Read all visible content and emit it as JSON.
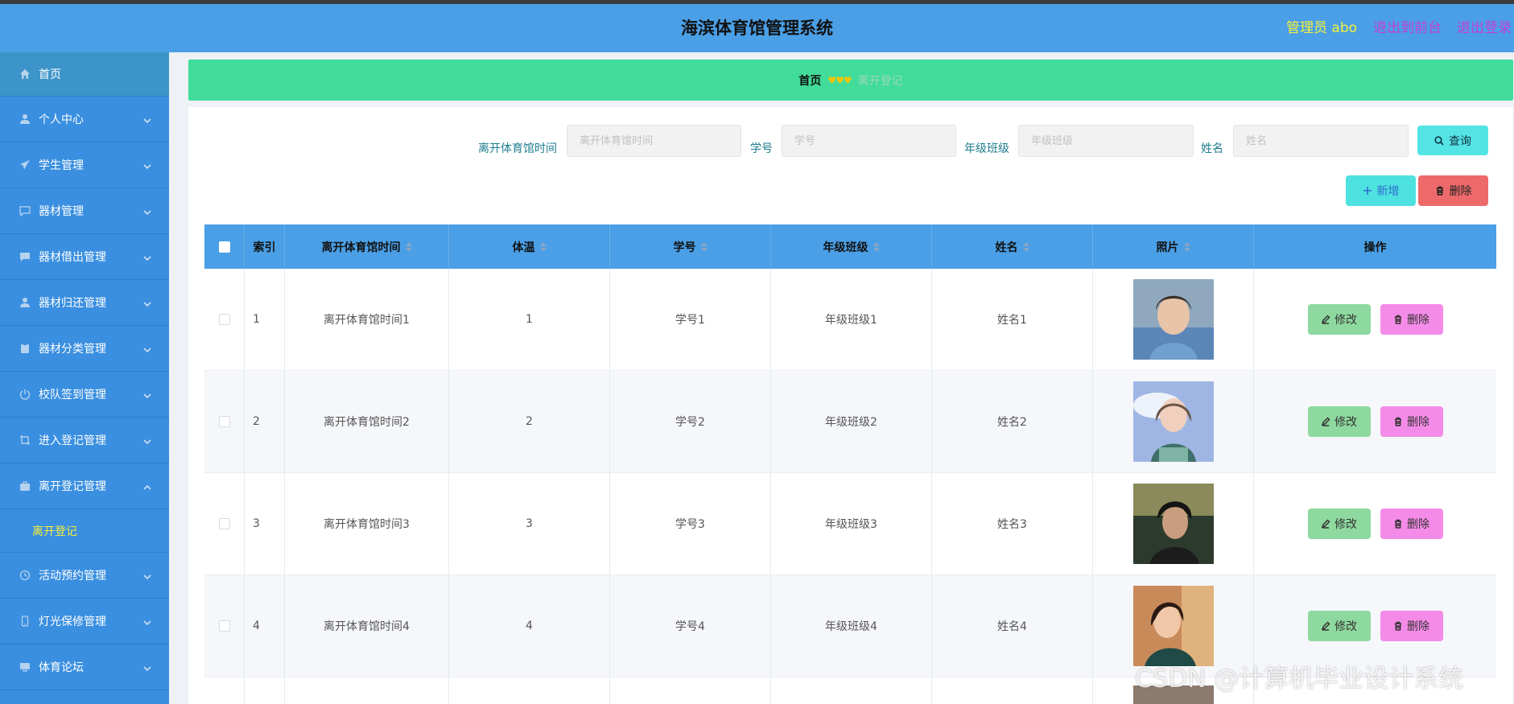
{
  "header": {
    "title": "海滨体育馆管理系统",
    "admin_label": "管理员 abo",
    "front_link": "退出到前台",
    "logout_link": "退出登录"
  },
  "sidebar": {
    "home": {
      "label": "首页",
      "icon": "home-icon"
    },
    "items": [
      {
        "label": "个人中心",
        "icon": "user-icon"
      },
      {
        "label": "学生管理",
        "icon": "send-icon"
      },
      {
        "label": "器材管理",
        "icon": "message-icon"
      },
      {
        "label": "器材借出管理",
        "icon": "chat-icon"
      },
      {
        "label": "器材归还管理",
        "icon": "user-icon"
      },
      {
        "label": "器材分类管理",
        "icon": "clipboard-icon"
      },
      {
        "label": "校队签到管理",
        "icon": "power-icon"
      },
      {
        "label": "进入登记管理",
        "icon": "crop-icon"
      },
      {
        "label": "离开登记管理",
        "icon": "briefcase-icon",
        "expanded": true
      }
    ],
    "submenu_label": "离开登记",
    "items_after": [
      {
        "label": "活动预约管理",
        "icon": "clock-icon"
      },
      {
        "label": "灯光保修管理",
        "icon": "phone-icon"
      },
      {
        "label": "体育论坛",
        "icon": "monitor-icon"
      }
    ]
  },
  "breadcrumb": {
    "home": "首页",
    "separator": "♥♥♥",
    "current": "离开登记"
  },
  "search": {
    "fields": [
      {
        "label": "离开体育馆时间",
        "placeholder": "离开体育馆时间"
      },
      {
        "label": "学号",
        "placeholder": "学号"
      },
      {
        "label": "年级班级",
        "placeholder": "年级班级"
      },
      {
        "label": "姓名",
        "placeholder": "姓名"
      }
    ],
    "query_button": "查询"
  },
  "actions": {
    "add_button": "新增",
    "delete_button": "删除"
  },
  "table": {
    "columns": [
      "索引",
      "离开体育馆时间",
      "体温",
      "学号",
      "年级班级",
      "姓名",
      "照片",
      "操作"
    ],
    "rows": [
      {
        "index": "1",
        "time": "离开体育馆时间1",
        "temp": "1",
        "sid": "学号1",
        "grade": "年级班级1",
        "name": "姓名1"
      },
      {
        "index": "2",
        "time": "离开体育馆时间2",
        "temp": "2",
        "sid": "学号2",
        "grade": "年级班级2",
        "name": "姓名2"
      },
      {
        "index": "3",
        "time": "离开体育馆时间3",
        "temp": "3",
        "sid": "学号3",
        "grade": "年级班级3",
        "name": "姓名3"
      },
      {
        "index": "4",
        "time": "离开体育馆时间4",
        "temp": "4",
        "sid": "学号4",
        "grade": "年级班级4",
        "name": "姓名4"
      }
    ],
    "edit_label": "修改",
    "delete_label": "删除"
  },
  "watermark": "CSDN @计算机毕业设计系统",
  "colors": {
    "header": "#4a9fe6",
    "sidebar": "#3a8fe0",
    "breadcrumb": "#41dc9a",
    "accent_yellow": "#f5ef3c",
    "link_purple": "#c43fd8"
  }
}
